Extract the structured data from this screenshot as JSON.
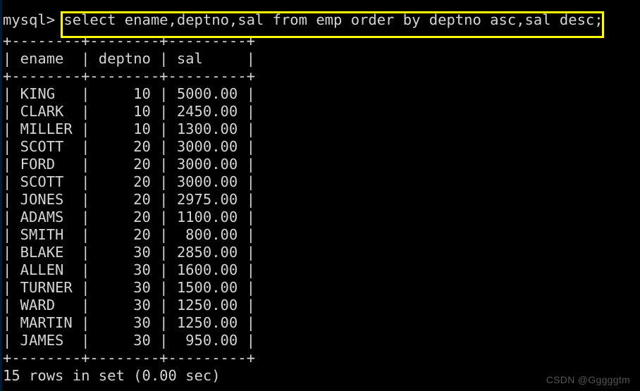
{
  "terminal": {
    "prompt": "mysql> ",
    "command": "select ename,deptno,sal from emp order by deptno asc,sal desc;",
    "separator": "+--------+--------+---------+",
    "header_line": "| ename  | deptno | sal     |",
    "status": "15 rows in set (0.00 sec)",
    "background_color": "#000000",
    "text_color": "#d4d4d4",
    "highlight_color": "#ffff00"
  },
  "table": {
    "columns": [
      "ename",
      "deptno",
      "sal"
    ],
    "rows": [
      {
        "ename": "KING",
        "deptno": "10",
        "sal": "5000.00"
      },
      {
        "ename": "CLARK",
        "deptno": "10",
        "sal": "2450.00"
      },
      {
        "ename": "MILLER",
        "deptno": "10",
        "sal": "1300.00"
      },
      {
        "ename": "SCOTT",
        "deptno": "20",
        "sal": "3000.00"
      },
      {
        "ename": "FORD",
        "deptno": "20",
        "sal": "3000.00"
      },
      {
        "ename": "SCOTT",
        "deptno": "20",
        "sal": "3000.00"
      },
      {
        "ename": "JONES",
        "deptno": "20",
        "sal": "2975.00"
      },
      {
        "ename": "ADAMS",
        "deptno": "20",
        "sal": "1100.00"
      },
      {
        "ename": "SMITH",
        "deptno": "20",
        "sal": "800.00"
      },
      {
        "ename": "BLAKE",
        "deptno": "30",
        "sal": "2850.00"
      },
      {
        "ename": "ALLEN",
        "deptno": "30",
        "sal": "1600.00"
      },
      {
        "ename": "TURNER",
        "deptno": "30",
        "sal": "1500.00"
      },
      {
        "ename": "WARD",
        "deptno": "30",
        "sal": "1250.00"
      },
      {
        "ename": "MARTIN",
        "deptno": "30",
        "sal": "1250.00"
      },
      {
        "ename": "JAMES",
        "deptno": "30",
        "sal": "950.00"
      }
    ],
    "row_count": 15
  },
  "watermark": {
    "text": "CSDN @Gggggtm"
  }
}
